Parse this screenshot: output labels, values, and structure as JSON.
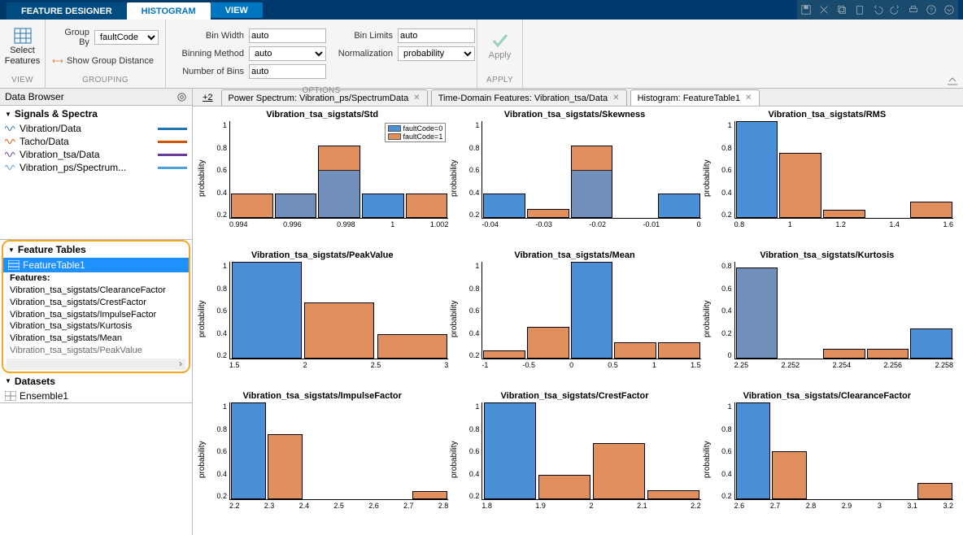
{
  "tabs": {
    "primary": "FEATURE DESIGNER",
    "active": "HISTOGRAM",
    "third": "VIEW"
  },
  "toolstrip": {
    "view": {
      "select_features": "Select\nFeatures",
      "title": "VIEW"
    },
    "grouping": {
      "group_by_label": "Group By",
      "group_by_value": "faultCode",
      "show_group_distance": "Show Group Distance",
      "title": "GROUPING"
    },
    "options": {
      "bin_width_label": "Bin Width",
      "bin_width_value": "auto",
      "binning_method_label": "Binning Method",
      "binning_method_value": "auto",
      "num_bins_label": "Number of Bins",
      "num_bins_value": "auto",
      "bin_limits_label": "Bin Limits",
      "bin_limits_value": "auto",
      "normalization_label": "Normalization",
      "normalization_value": "probability",
      "title": "OPTIONS"
    },
    "apply": {
      "label": "Apply",
      "title": "APPLY"
    }
  },
  "data_browser": {
    "title": "Data Browser",
    "signals_title": "Signals & Spectra",
    "signals": [
      {
        "name": "Vibration/Data",
        "color": "#1f77b4"
      },
      {
        "name": "Tacho/Data",
        "color": "#d35400"
      },
      {
        "name": "Vibration_tsa/Data",
        "color": "#6a3d9a"
      },
      {
        "name": "Vibration_ps/Spectrum...",
        "color": "#4aa3df"
      }
    ],
    "feature_tables_title": "Feature Tables",
    "feature_table_name": "FeatureTable1",
    "features_label": "Features:",
    "features": [
      "Vibration_tsa_sigstats/ClearanceFactor",
      "Vibration_tsa_sigstats/CrestFactor",
      "Vibration_tsa_sigstats/ImpulseFactor",
      "Vibration_tsa_sigstats/Kurtosis",
      "Vibration_tsa_sigstats/Mean",
      "Vibration_tsa_sigstats/PeakValue"
    ],
    "datasets_title": "Datasets",
    "dataset_name": "Ensemble1"
  },
  "doctabs": {
    "plus": "+2",
    "t1": "Power Spectrum: Vibration_ps/SpectrumData",
    "t2": "Time-Domain Features: Vibration_tsa/Data",
    "t3": "Histogram: FeatureTable1"
  },
  "legend": {
    "l0": "faultCode=0",
    "l1": "faultCode=1"
  },
  "ylabel": "probability",
  "chart_data": [
    {
      "title": "Vibration_tsa_sigstats/Std",
      "type": "bar",
      "ylabel": "probability",
      "ylim": [
        0,
        1
      ],
      "yticks": [
        1,
        0.8,
        0.6,
        0.4,
        0.2
      ],
      "categories": [
        0.994,
        0.996,
        0.998,
        1,
        1.002
      ],
      "series": [
        {
          "name": "faultCode=0",
          "values": [
            0,
            0.25,
            0.5,
            0.25,
            0
          ]
        },
        {
          "name": "faultCode=1",
          "values": [
            0.25,
            0.25,
            0.75,
            0,
            0.25
          ]
        }
      ],
      "show_legend": true
    },
    {
      "title": "Vibration_tsa_sigstats/Skewness",
      "type": "bar",
      "ylabel": "probability",
      "ylim": [
        0,
        1
      ],
      "yticks": [
        1,
        0.8,
        0.6,
        0.4,
        0.2
      ],
      "categories": [
        -0.04,
        -0.03,
        -0.02,
        -0.01,
        0
      ],
      "series": [
        {
          "name": "faultCode=0",
          "values": [
            0.25,
            0,
            0.5,
            0,
            0.25
          ]
        },
        {
          "name": "faultCode=1",
          "values": [
            0.18,
            0.09,
            0.75,
            0,
            0
          ]
        }
      ]
    },
    {
      "title": "Vibration_tsa_sigstats/RMS",
      "type": "bar",
      "ylabel": "probability",
      "ylim": [
        0,
        1
      ],
      "yticks": [
        1,
        0.8,
        0.6,
        0.4,
        0.2
      ],
      "categories": [
        0.8,
        1,
        1.2,
        1.4,
        1.6
      ],
      "series": [
        {
          "name": "faultCode=0",
          "values": [
            1,
            0,
            0,
            0,
            0
          ]
        },
        {
          "name": "faultCode=1",
          "values": [
            0.08,
            0.67,
            0.08,
            0,
            0.17
          ]
        }
      ]
    },
    {
      "title": "Vibration_tsa_sigstats/PeakValue",
      "type": "bar",
      "ylabel": "probability",
      "ylim": [
        0,
        1
      ],
      "yticks": [
        1,
        0.8,
        0.6,
        0.4,
        0.2
      ],
      "categories": [
        1.5,
        2,
        2.5,
        3
      ],
      "series": [
        {
          "name": "faultCode=0",
          "values": [
            1,
            0,
            0
          ]
        },
        {
          "name": "faultCode=1",
          "values": [
            0.17,
            0.58,
            0.25
          ]
        }
      ]
    },
    {
      "title": "Vibration_tsa_sigstats/Mean",
      "type": "bar",
      "ylabel": "probability",
      "ylim": [
        0,
        1
      ],
      "yticks": [
        1,
        0.8,
        0.6,
        0.4,
        0.2
      ],
      "categories": [
        -1,
        -0.5,
        0,
        0.5,
        1,
        1.5
      ],
      "series": [
        {
          "name": "faultCode=0",
          "values": [
            0,
            0,
            1,
            0,
            0
          ]
        },
        {
          "name": "faultCode=1",
          "values": [
            0.08,
            0.33,
            0.25,
            0.17,
            0.17
          ]
        }
      ]
    },
    {
      "title": "Vibration_tsa_sigstats/Kurtosis",
      "type": "bar",
      "ylabel": "probability",
      "ylim": [
        0,
        0.8
      ],
      "yticks": [
        0.8,
        0.6,
        0.4,
        0.2,
        0
      ],
      "categories": [
        2.25,
        2.252,
        2.254,
        2.256,
        2.258
      ],
      "series": [
        {
          "name": "faultCode=0",
          "values": [
            0.75,
            0,
            0,
            0,
            0.25
          ]
        },
        {
          "name": "faultCode=1",
          "values": [
            0.75,
            0,
            0.08,
            0.08,
            0.08
          ]
        }
      ]
    },
    {
      "title": "Vibration_tsa_sigstats/ImpulseFactor",
      "type": "bar",
      "ylabel": "probability",
      "ylim": [
        0,
        1
      ],
      "yticks": [
        1,
        0.8,
        0.6,
        0.4,
        0.2
      ],
      "categories": [
        2.2,
        2.3,
        2.4,
        2.5,
        2.6,
        2.7,
        2.8
      ],
      "series": [
        {
          "name": "faultCode=0",
          "values": [
            1,
            0,
            0,
            0,
            0,
            0
          ]
        },
        {
          "name": "faultCode=1",
          "values": [
            0.25,
            0.67,
            0,
            0,
            0,
            0.08
          ]
        }
      ]
    },
    {
      "title": "Vibration_tsa_sigstats/CrestFactor",
      "type": "bar",
      "ylabel": "probability",
      "ylim": [
        0,
        1
      ],
      "yticks": [
        1,
        0.8,
        0.6,
        0.4,
        0.2
      ],
      "categories": [
        1.8,
        1.9,
        2,
        2.1,
        2.2
      ],
      "series": [
        {
          "name": "faultCode=0",
          "values": [
            1,
            0,
            0,
            0
          ]
        },
        {
          "name": "faultCode=1",
          "values": [
            0.09,
            0.25,
            0.58,
            0.09
          ]
        }
      ]
    },
    {
      "title": "Vibration_tsa_sigstats/ClearanceFactor",
      "type": "bar",
      "ylabel": "probability",
      "ylim": [
        0,
        1
      ],
      "yticks": [
        1,
        0.8,
        0.6,
        0.4,
        0.2
      ],
      "categories": [
        2.6,
        2.7,
        2.8,
        2.9,
        3,
        3.1,
        3.2
      ],
      "series": [
        {
          "name": "faultCode=0",
          "values": [
            1,
            0,
            0,
            0,
            0,
            0
          ]
        },
        {
          "name": "faultCode=1",
          "values": [
            0.33,
            0.5,
            0,
            0,
            0,
            0.17
          ]
        }
      ]
    }
  ]
}
